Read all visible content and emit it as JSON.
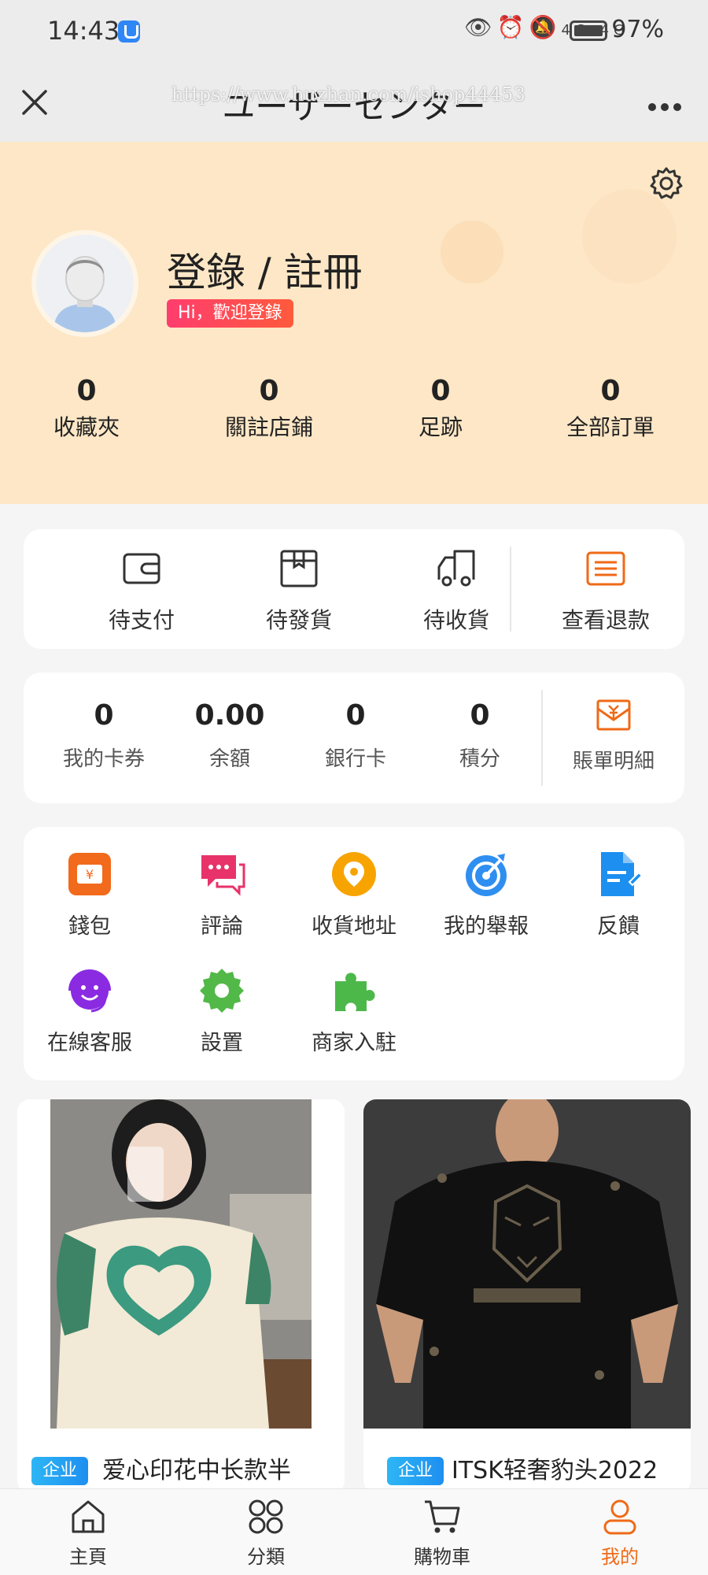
{
  "status_bar": {
    "time": "14:43",
    "network": "4G 4G",
    "battery": "97%"
  },
  "title_bar": {
    "title": "ユーザーセンター",
    "watermark": "https://www.huzhan.com/ishop44453"
  },
  "header": {
    "login_title": "登錄 / 註冊",
    "welcome": "Hi，歡迎登錄",
    "stats": [
      {
        "value": "0",
        "label": "收藏夾"
      },
      {
        "value": "0",
        "label": "關註店鋪"
      },
      {
        "value": "0",
        "label": "足跡"
      },
      {
        "value": "0",
        "label": "全部訂單"
      }
    ]
  },
  "orders": {
    "items": [
      {
        "label": "待支付",
        "icon": "wallet-icon"
      },
      {
        "label": "待發貨",
        "icon": "box-icon"
      },
      {
        "label": "待收貨",
        "icon": "truck-icon"
      },
      {
        "label": "查看退款",
        "icon": "list-icon"
      }
    ]
  },
  "assets": {
    "items": [
      {
        "value": "0",
        "label": "我的卡券"
      },
      {
        "value": "0.00",
        "label": "余額"
      },
      {
        "value": "0",
        "label": "銀行卡"
      },
      {
        "value": "0",
        "label": "積分"
      }
    ],
    "bill_label": "賬單明細"
  },
  "tools": {
    "items": [
      {
        "label": "錢包",
        "icon": "wallet-icon",
        "color": "#f26a1b"
      },
      {
        "label": "評論",
        "icon": "comment-icon",
        "color": "#e8336a"
      },
      {
        "label": "收貨地址",
        "icon": "location-icon",
        "color": "#f7a400"
      },
      {
        "label": "我的舉報",
        "icon": "target-icon",
        "color": "#2f8ff0"
      },
      {
        "label": "反饋",
        "icon": "feedback-icon",
        "color": "#1c8ff0"
      },
      {
        "label": "在線客服",
        "icon": "support-icon",
        "color": "#8a2be2"
      },
      {
        "label": "設置",
        "icon": "gear-icon",
        "color": "#52b848"
      },
      {
        "label": "商家入駐",
        "icon": "puzzle-icon",
        "color": "#4cb84a"
      }
    ]
  },
  "products": [
    {
      "tag": "企业",
      "title": "爱心印花中长款半"
    },
    {
      "tag": "企业",
      "title": "ITSK轻奢豹头2022"
    }
  ],
  "tabbar": {
    "items": [
      {
        "label": "主頁",
        "icon": "home-icon"
      },
      {
        "label": "分類",
        "icon": "category-icon"
      },
      {
        "label": "購物車",
        "icon": "cart-icon"
      },
      {
        "label": "我的",
        "icon": "user-icon",
        "active": true
      }
    ]
  },
  "colors": {
    "accent": "#ef6a17",
    "header_bg": "#fde7c6",
    "badge": "#ff3d6e",
    "tag": "#1e8ff0"
  }
}
